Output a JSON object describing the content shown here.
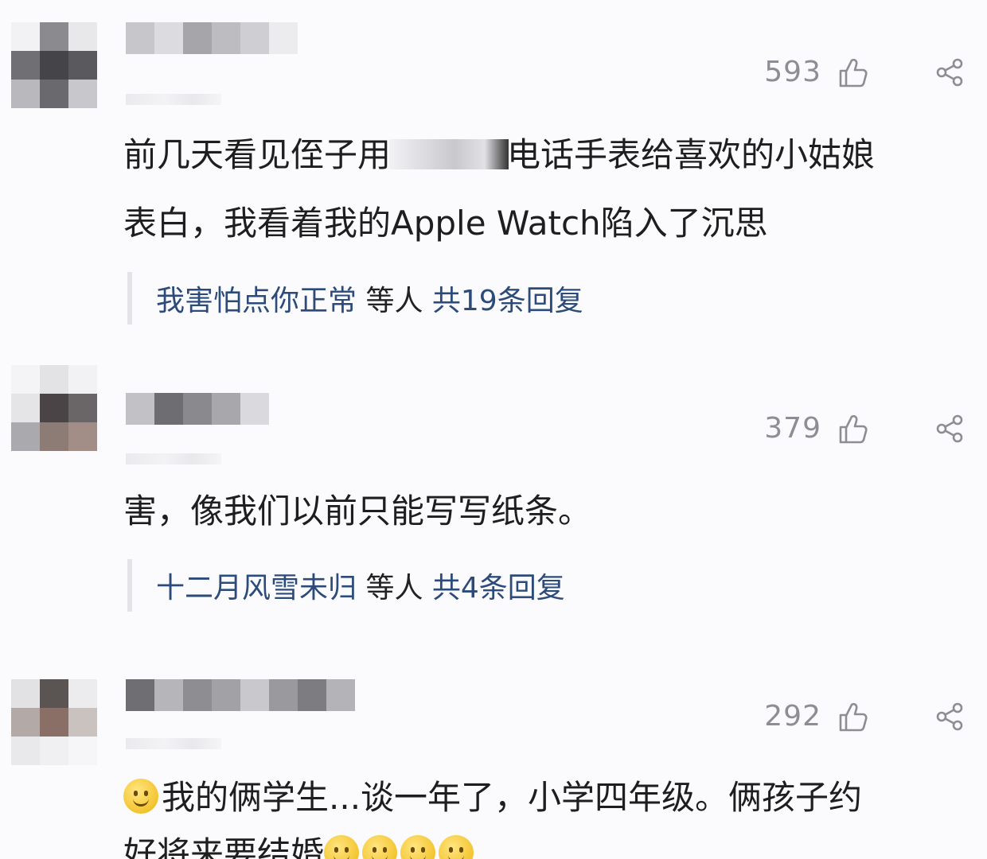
{
  "colors": {
    "link": "#2d4b7a",
    "count": "#8d8d93",
    "text": "#1e1e1e"
  },
  "icons": {
    "like": "thumbs-up-icon",
    "share": "share-icon"
  },
  "comments": [
    {
      "likes": "593",
      "text_before": "前几天看见侄子用",
      "text_after": "电话手表给喜欢的小姑娘\n表白，我看着我的Apple Watch陷入了沉思",
      "reply_names": "我害怕点你正常",
      "reply_mid": " 等人 ",
      "reply_count": "共19条回复"
    },
    {
      "likes": "379",
      "text": "害，像我们以前只能写写纸条。",
      "reply_names": "十二月风雪未归",
      "reply_mid": " 等人 ",
      "reply_count": "共4条回复"
    },
    {
      "likes": "292",
      "text": "我的俩学生...谈一年了，小学四年级。俩孩子约",
      "text_cut": "好将来要结婚"
    }
  ]
}
